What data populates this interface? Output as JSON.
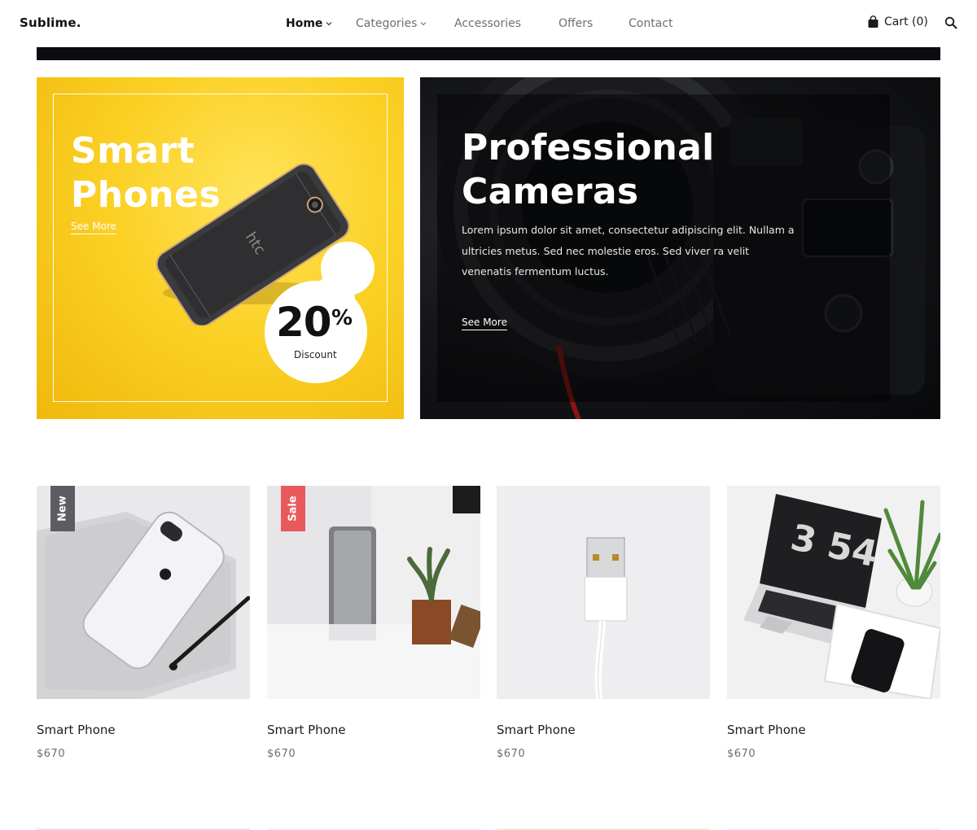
{
  "brand": {
    "logo": "Sublime."
  },
  "nav": {
    "items": [
      {
        "label": "Home",
        "has_dropdown": true,
        "active": true
      },
      {
        "label": "Categories",
        "has_dropdown": true,
        "active": false
      },
      {
        "label": "Accessories",
        "has_dropdown": false,
        "active": false
      },
      {
        "label": "Offers",
        "has_dropdown": false,
        "active": false
      },
      {
        "label": "Contact",
        "has_dropdown": false,
        "active": false
      }
    ],
    "cart_label": "Cart (0)",
    "icons": {
      "cart": "shopping-bag-icon",
      "search": "search-icon",
      "dropdown": "chevron-down-icon"
    }
  },
  "hero": {
    "left_banner": {
      "title_line1": "Smart",
      "title_line2": "Phones",
      "link": "See More",
      "discount_value": "20",
      "discount_percent_sign": "%",
      "discount_label": "Discount",
      "background_color": "#fbd126"
    },
    "right_banner": {
      "title_line1": "Professional",
      "title_line2": "Cameras",
      "description": "Lorem ipsum dolor sit amet, consectetur adipiscing elit. Nullam a ultricies metus. Sed nec molestie eros. Sed viver ra velit venenatis fermentum luctus.",
      "link": "See More",
      "background_color": "#111214"
    }
  },
  "products": [
    {
      "name": "Smart Phone",
      "price": "$670",
      "badge": "New",
      "image": "white-iphone-on-notebook"
    },
    {
      "name": "Smart Phone",
      "price": "$670",
      "badge": "Sale",
      "image": "speaker-with-plant"
    },
    {
      "name": "Smart Phone",
      "price": "$670",
      "badge": "",
      "image": "usb-cable"
    },
    {
      "name": "Smart Phone",
      "price": "$670",
      "badge": "",
      "image": "laptop-with-clock-and-plant"
    }
  ],
  "colors": {
    "badge_new": "#5d5c63",
    "badge_sale": "#e8595c",
    "text_primary": "#1a1a1a",
    "text_muted": "#6d6d6d"
  }
}
